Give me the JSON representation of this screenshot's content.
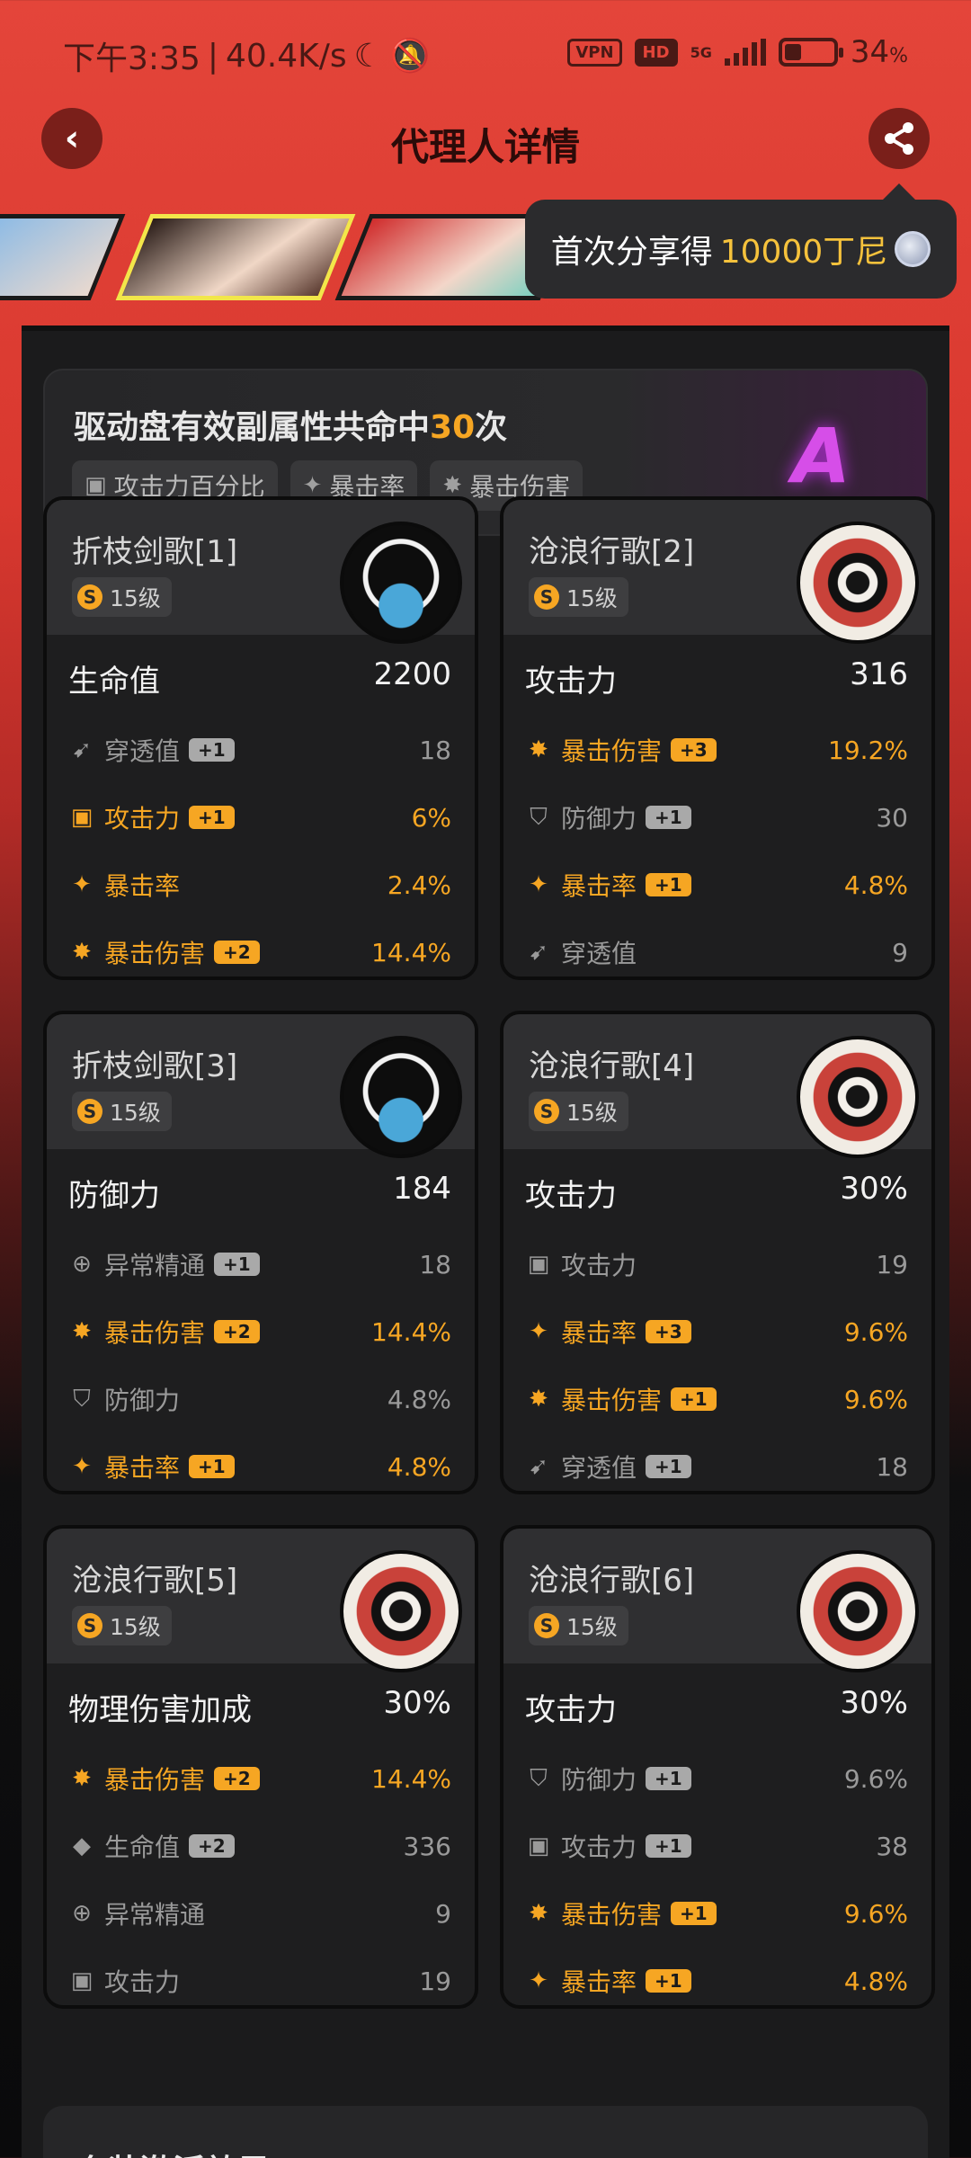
{
  "status": {
    "time": "下午3:35",
    "speed": "40.4K/s",
    "vpn": "VPN",
    "hd": "HD",
    "network": "5G",
    "battery": "34",
    "battery_unit": "%",
    "battery_level": 0.34
  },
  "header": {
    "title": "代理人详情",
    "back_glyph": "‹",
    "share_glyph": "⋖"
  },
  "tooltip": {
    "prefix": "首次分享得",
    "amount": "10000丁尼"
  },
  "summary": {
    "title_prefix": "驱动盘有效副属性共命中",
    "hits": "30",
    "title_suffix": "次",
    "tags": [
      "攻击力百分比",
      "暴击率",
      "暴击伤害"
    ],
    "grade": "A"
  },
  "cards": [
    {
      "name": "折枝剑歌[1]",
      "level": "15级",
      "disc": "katana",
      "main": {
        "label": "生命值",
        "value": "2200"
      },
      "subs": [
        {
          "icon": "pen-icon",
          "glyph": "➹",
          "label": "穿透值",
          "boost": "+1",
          "value": "18",
          "hit": false
        },
        {
          "icon": "attack-icon",
          "glyph": "▣",
          "label": "攻击力",
          "boost": "+1",
          "value": "6%",
          "hit": true
        },
        {
          "icon": "crit-rate-icon",
          "glyph": "✦",
          "label": "暴击率",
          "boost": "",
          "value": "2.4%",
          "hit": true
        },
        {
          "icon": "crit-dmg-icon",
          "glyph": "✸",
          "label": "暴击伤害",
          "boost": "+2",
          "value": "14.4%",
          "hit": true
        }
      ]
    },
    {
      "name": "沧浪行歌[2]",
      "level": "15级",
      "disc": "wave",
      "main": {
        "label": "攻击力",
        "value": "316"
      },
      "subs": [
        {
          "icon": "crit-dmg-icon",
          "glyph": "✸",
          "label": "暴击伤害",
          "boost": "+3",
          "value": "19.2%",
          "hit": true
        },
        {
          "icon": "defense-icon",
          "glyph": "⛉",
          "label": "防御力",
          "boost": "+1",
          "value": "30",
          "hit": false
        },
        {
          "icon": "crit-rate-icon",
          "glyph": "✦",
          "label": "暴击率",
          "boost": "+1",
          "value": "4.8%",
          "hit": true
        },
        {
          "icon": "pen-icon",
          "glyph": "➹",
          "label": "穿透值",
          "boost": "",
          "value": "9",
          "hit": false
        }
      ]
    },
    {
      "name": "折枝剑歌[3]",
      "level": "15级",
      "disc": "katana",
      "main": {
        "label": "防御力",
        "value": "184"
      },
      "subs": [
        {
          "icon": "anomaly-icon",
          "glyph": "⊕",
          "label": "异常精通",
          "boost": "+1",
          "value": "18",
          "hit": false
        },
        {
          "icon": "crit-dmg-icon",
          "glyph": "✸",
          "label": "暴击伤害",
          "boost": "+2",
          "value": "14.4%",
          "hit": true
        },
        {
          "icon": "defense-icon",
          "glyph": "⛉",
          "label": "防御力",
          "boost": "",
          "value": "4.8%",
          "hit": false
        },
        {
          "icon": "crit-rate-icon",
          "glyph": "✦",
          "label": "暴击率",
          "boost": "+1",
          "value": "4.8%",
          "hit": true
        }
      ]
    },
    {
      "name": "沧浪行歌[4]",
      "level": "15级",
      "disc": "wave",
      "main": {
        "label": "攻击力",
        "value": "30%"
      },
      "subs": [
        {
          "icon": "attack-icon",
          "glyph": "▣",
          "label": "攻击力",
          "boost": "",
          "value": "19",
          "hit": false
        },
        {
          "icon": "crit-rate-icon",
          "glyph": "✦",
          "label": "暴击率",
          "boost": "+3",
          "value": "9.6%",
          "hit": true
        },
        {
          "icon": "crit-dmg-icon",
          "glyph": "✸",
          "label": "暴击伤害",
          "boost": "+1",
          "value": "9.6%",
          "hit": true
        },
        {
          "icon": "pen-icon",
          "glyph": "➹",
          "label": "穿透值",
          "boost": "+1",
          "value": "18",
          "hit": false
        }
      ]
    },
    {
      "name": "沧浪行歌[5]",
      "level": "15级",
      "disc": "wave",
      "main": {
        "label": "物理伤害加成",
        "value": "30%"
      },
      "subs": [
        {
          "icon": "crit-dmg-icon",
          "glyph": "✸",
          "label": "暴击伤害",
          "boost": "+2",
          "value": "14.4%",
          "hit": true
        },
        {
          "icon": "hp-icon",
          "glyph": "◆",
          "label": "生命值",
          "boost": "+2",
          "value": "336",
          "hit": false
        },
        {
          "icon": "anomaly-icon",
          "glyph": "⊕",
          "label": "异常精通",
          "boost": "",
          "value": "9",
          "hit": false
        },
        {
          "icon": "attack-icon",
          "glyph": "▣",
          "label": "攻击力",
          "boost": "",
          "value": "19",
          "hit": false
        }
      ]
    },
    {
      "name": "沧浪行歌[6]",
      "level": "15级",
      "disc": "wave",
      "main": {
        "label": "攻击力",
        "value": "30%"
      },
      "subs": [
        {
          "icon": "defense-icon",
          "glyph": "⛉",
          "label": "防御力",
          "boost": "+1",
          "value": "9.6%",
          "hit": false
        },
        {
          "icon": "attack-icon",
          "glyph": "▣",
          "label": "攻击力",
          "boost": "+1",
          "value": "38",
          "hit": false
        },
        {
          "icon": "crit-dmg-icon",
          "glyph": "✸",
          "label": "暴击伤害",
          "boost": "+1",
          "value": "9.6%",
          "hit": true
        },
        {
          "icon": "crit-rate-icon",
          "glyph": "✦",
          "label": "暴击率",
          "boost": "+1",
          "value": "4.8%",
          "hit": true
        }
      ]
    }
  ],
  "set_effect": {
    "title": "套装激活效果"
  },
  "colors": {
    "accent_red": "#e4453a",
    "hit_orange": "#f6a623",
    "grade_purple": "#d64ee8"
  }
}
